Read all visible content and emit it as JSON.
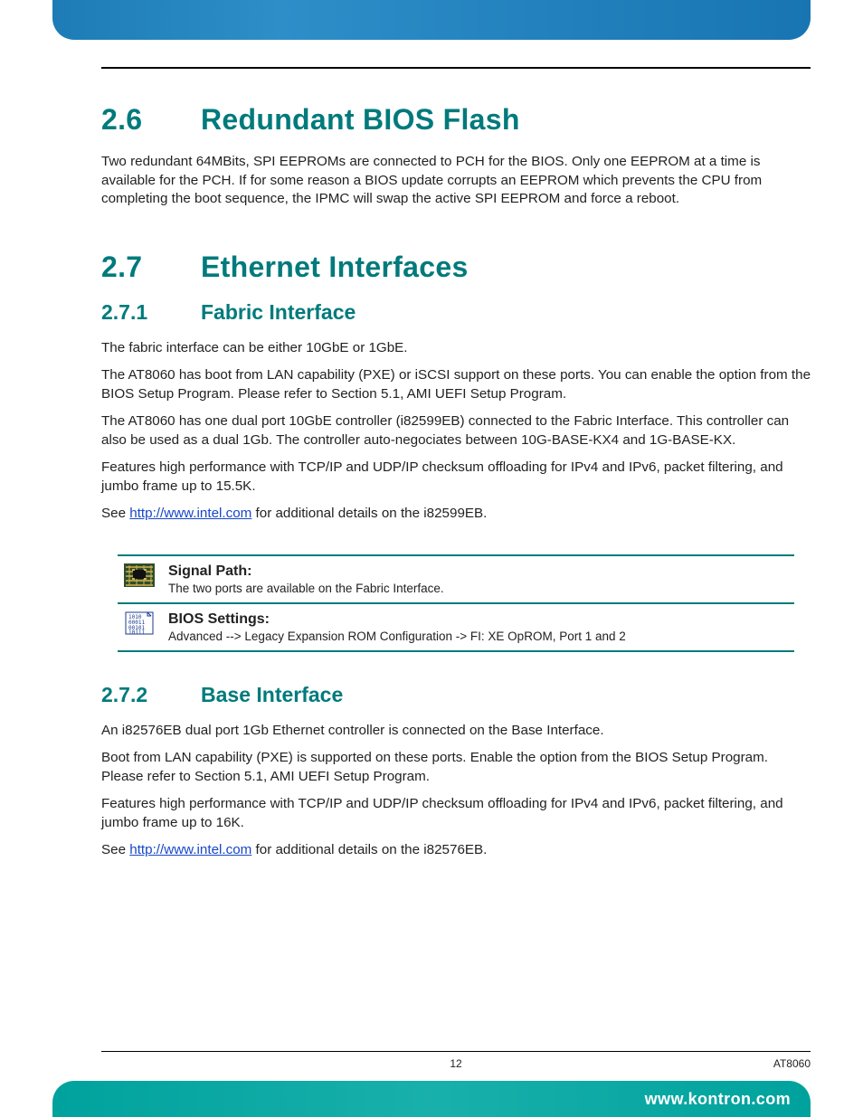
{
  "section26": {
    "num": "2.6",
    "title": "Redundant BIOS Flash",
    "p1": "Two redundant 64MBits, SPI EEPROMs are connected to PCH for the BIOS. Only one EEPROM at a time is available for the PCH. If for some reason a BIOS update corrupts an EEPROM which prevents the CPU from completing the boot sequence, the IPMC will swap the active SPI EEPROM and force a reboot."
  },
  "section27": {
    "num": "2.7",
    "title": "Ethernet Interfaces",
    "s271": {
      "num": "2.7.1",
      "title": "Fabric Interface",
      "p1": "The fabric interface can be either 10GbE or 1GbE.",
      "p2": "The AT8060 has boot from LAN capability (PXE) or iSCSI support on these ports. You can enable the option from the BIOS Setup Program. Please refer to Section 5.1, AMI UEFI Setup Program.",
      "p3": "The AT8060 has one dual port 10GbE controller (i82599EB) connected to the Fabric Interface. This controller can also be used as a dual 1Gb. The controller auto-negociates between 10G-BASE-KX4 and 1G-BASE-KX.",
      "p4": "Features high performance with TCP/IP and UDP/IP checksum offloading for IPv4 and IPv6, packet filtering, and jumbo frame up to 15.5K.",
      "p5_pre": "See ",
      "p5_link": "http://www.intel.com",
      "p5_post": " for additional details on the i82599EB.",
      "note_signal_title": "Signal Path:",
      "note_signal_text": "The two ports are available on the Fabric Interface.",
      "note_bios_title": "BIOS Settings:",
      "note_bios_text": "Advanced --> Legacy Expansion ROM Configuration -> FI: XE OpROM, Port 1 and 2"
    },
    "s272": {
      "num": "2.7.2",
      "title": "Base Interface",
      "p1": "An i82576EB dual port 1Gb Ethernet controller is connected on the Base Interface.",
      "p2": "Boot from LAN capability (PXE) is supported on these ports. Enable the option from the BIOS Setup Program. Please refer to Section 5.1, AMI UEFI Setup Program.",
      "p3": "Features high performance with TCP/IP and UDP/IP checksum offloading for IPv4 and IPv6, packet filtering, and jumbo frame up to 16K.",
      "p4_pre": "See ",
      "p4_link": "http://www.intel.com",
      "p4_post": " for additional details on the i82576EB."
    }
  },
  "footer": {
    "page": "12",
    "doc": "AT8060",
    "url": "www.kontron.com"
  }
}
